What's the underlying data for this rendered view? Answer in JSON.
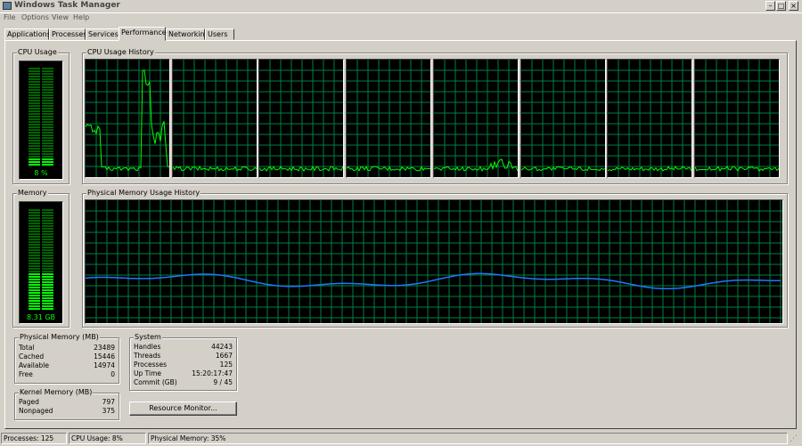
{
  "window": {
    "title": "Windows Task Manager",
    "minimize_glyph": "–",
    "maximize_glyph": "□",
    "close_glyph": "×"
  },
  "menu": [
    "File",
    "Options",
    "View",
    "Help"
  ],
  "tabs": [
    "Applications",
    "Processes",
    "Services",
    "Performance",
    "Networking",
    "Users"
  ],
  "active_tab": "Performance",
  "cpu": {
    "label": "CPU Usage",
    "value": "8 %",
    "level": 0.08
  },
  "cpu_history": {
    "label": "CPU Usage History",
    "core_count": 8
  },
  "memory": {
    "label": "Memory",
    "value": "8.31 GB",
    "level": 0.36
  },
  "mem_history": {
    "label": "Physical Memory Usage History"
  },
  "physical_memory": {
    "label": "Physical Memory (MB)",
    "rows": [
      {
        "name": "Total",
        "value": "23489"
      },
      {
        "name": "Cached",
        "value": "15446"
      },
      {
        "name": "Available",
        "value": "14974"
      },
      {
        "name": "Free",
        "value": "0"
      }
    ]
  },
  "kernel_memory": {
    "label": "Kernel Memory (MB)",
    "rows": [
      {
        "name": "Paged",
        "value": "797"
      },
      {
        "name": "Nonpaged",
        "value": "375"
      }
    ]
  },
  "system": {
    "label": "System",
    "rows": [
      {
        "name": "Handles",
        "value": "44243"
      },
      {
        "name": "Threads",
        "value": "1667"
      },
      {
        "name": "Processes",
        "value": "125"
      },
      {
        "name": "Up Time",
        "value": "15:20:17:47"
      },
      {
        "name": "Commit (GB)",
        "value": "9 / 45"
      }
    ]
  },
  "resource_monitor_button": "Resource Monitor...",
  "status": {
    "processes": "Processes: 125",
    "cpu": "CPU Usage: 8%",
    "memory": "Physical Memory: 35%"
  },
  "colors": {
    "grid": "#008040",
    "cpu_line": "#00ff00",
    "mem_line": "#1e78ff",
    "gauge_on": "#00ff00",
    "gauge_off": "#006400"
  }
}
